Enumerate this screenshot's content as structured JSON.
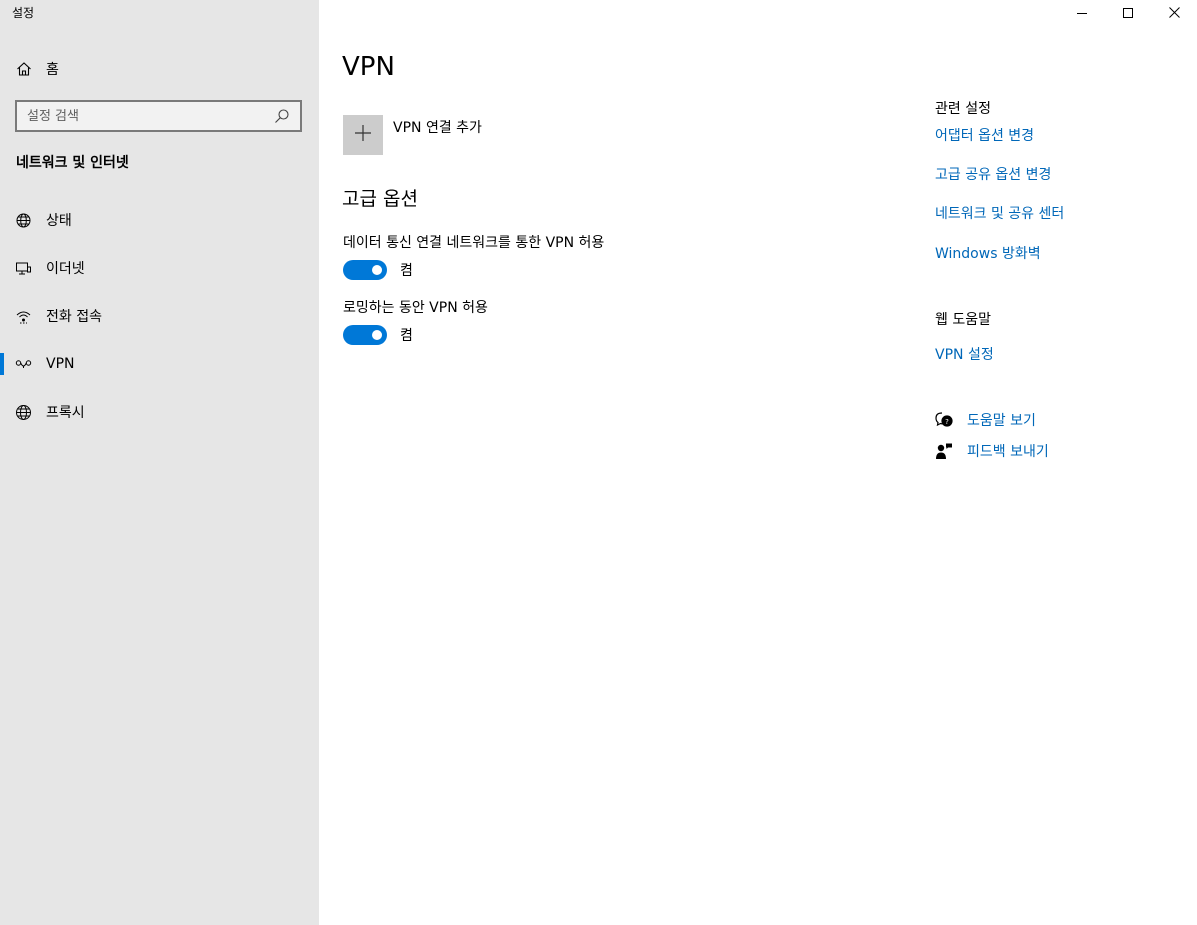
{
  "app_title": "설정",
  "sidebar": {
    "home_label": "홈",
    "search_placeholder": "설정 검색",
    "section_title": "네트워크 및 인터넷",
    "items": [
      {
        "label": "상태",
        "icon": "globe-status-icon",
        "active": false
      },
      {
        "label": "이더넷",
        "icon": "ethernet-icon",
        "active": false
      },
      {
        "label": "전화 접속",
        "icon": "dialup-icon",
        "active": false
      },
      {
        "label": "VPN",
        "icon": "vpn-icon",
        "active": true
      },
      {
        "label": "프록시",
        "icon": "globe-icon",
        "active": false
      }
    ]
  },
  "main": {
    "title": "VPN",
    "add_vpn_label": "VPN 연결 추가",
    "advanced_title": "고급 옵션",
    "options": [
      {
        "label": "데이터 통신 연결 네트워크를 통한 VPN 허용",
        "state": "켬",
        "on": true
      },
      {
        "label": "로밍하는 동안 VPN 허용",
        "state": "켬",
        "on": true
      }
    ]
  },
  "related": {
    "title": "관련 설정",
    "links": [
      "어댑터 옵션 변경",
      "고급 공유 옵션 변경",
      "네트워크 및 공유 센터",
      "Windows 방화벽"
    ]
  },
  "web_help": {
    "title": "웹 도움말",
    "links": [
      "VPN 설정"
    ]
  },
  "help": {
    "get_help": "도움말 보기",
    "feedback": "피드백 보내기"
  },
  "colors": {
    "accent": "#0078d7",
    "link": "#0067b8",
    "sidebar_bg": "#e6e6e6"
  }
}
